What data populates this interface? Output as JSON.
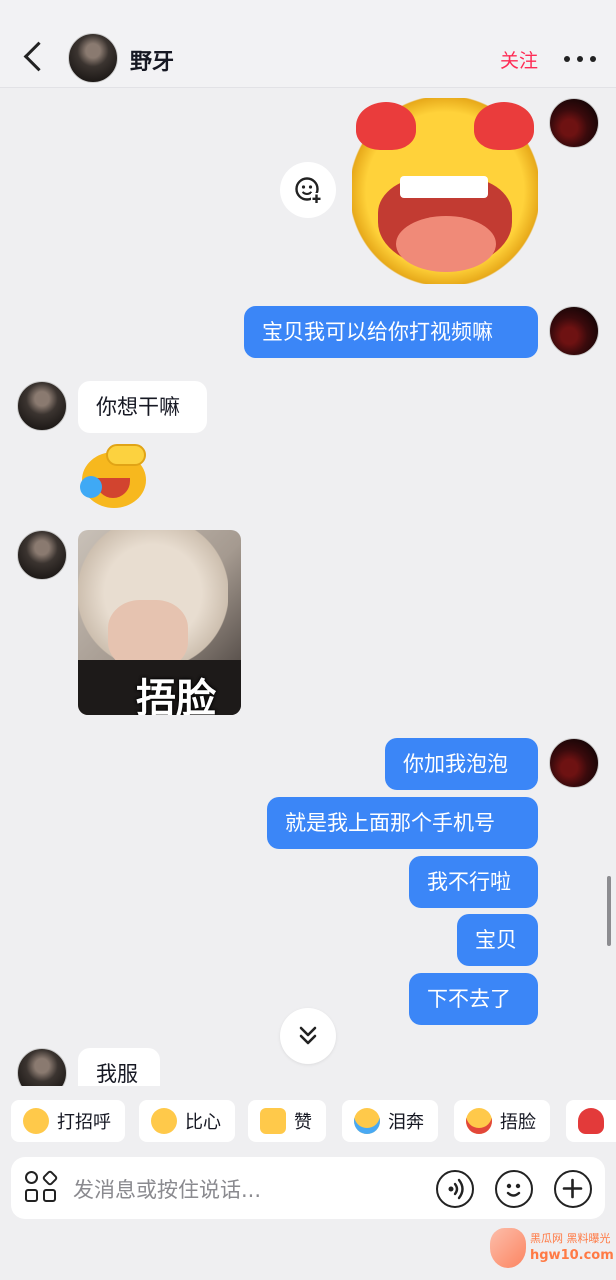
{
  "header": {
    "contact_name": "野牙",
    "follow_label": "关注"
  },
  "messages": {
    "m1": "宝贝我可以给你打视频嘛",
    "m2": "你想干嘛",
    "m3_caption": "捂脸",
    "m4": "你加我泡泡",
    "m5": "就是我上面那个手机号",
    "m6": "我不行啦",
    "m7": "宝贝",
    "m8": "下不去了",
    "m9": "我服"
  },
  "quick_replies": [
    {
      "label": "打招呼",
      "icon": "wave-emoji-icon"
    },
    {
      "label": "比心",
      "icon": "heart-hands-emoji-icon"
    },
    {
      "label": "赞",
      "icon": "thumbs-up-emoji-icon"
    },
    {
      "label": "泪奔",
      "icon": "crying-emoji-icon"
    },
    {
      "label": "捂脸",
      "icon": "facepalm-emoji-icon"
    }
  ],
  "input": {
    "placeholder": "发消息或按住说话..."
  },
  "watermark": {
    "line1": "黑瓜网 黑料曝光",
    "line2": "hgw10.com"
  },
  "colors": {
    "outgoing_bubble": "#3b86f7",
    "incoming_bubble": "#ffffff",
    "follow": "#fe2c55",
    "background": "#efeff1"
  }
}
